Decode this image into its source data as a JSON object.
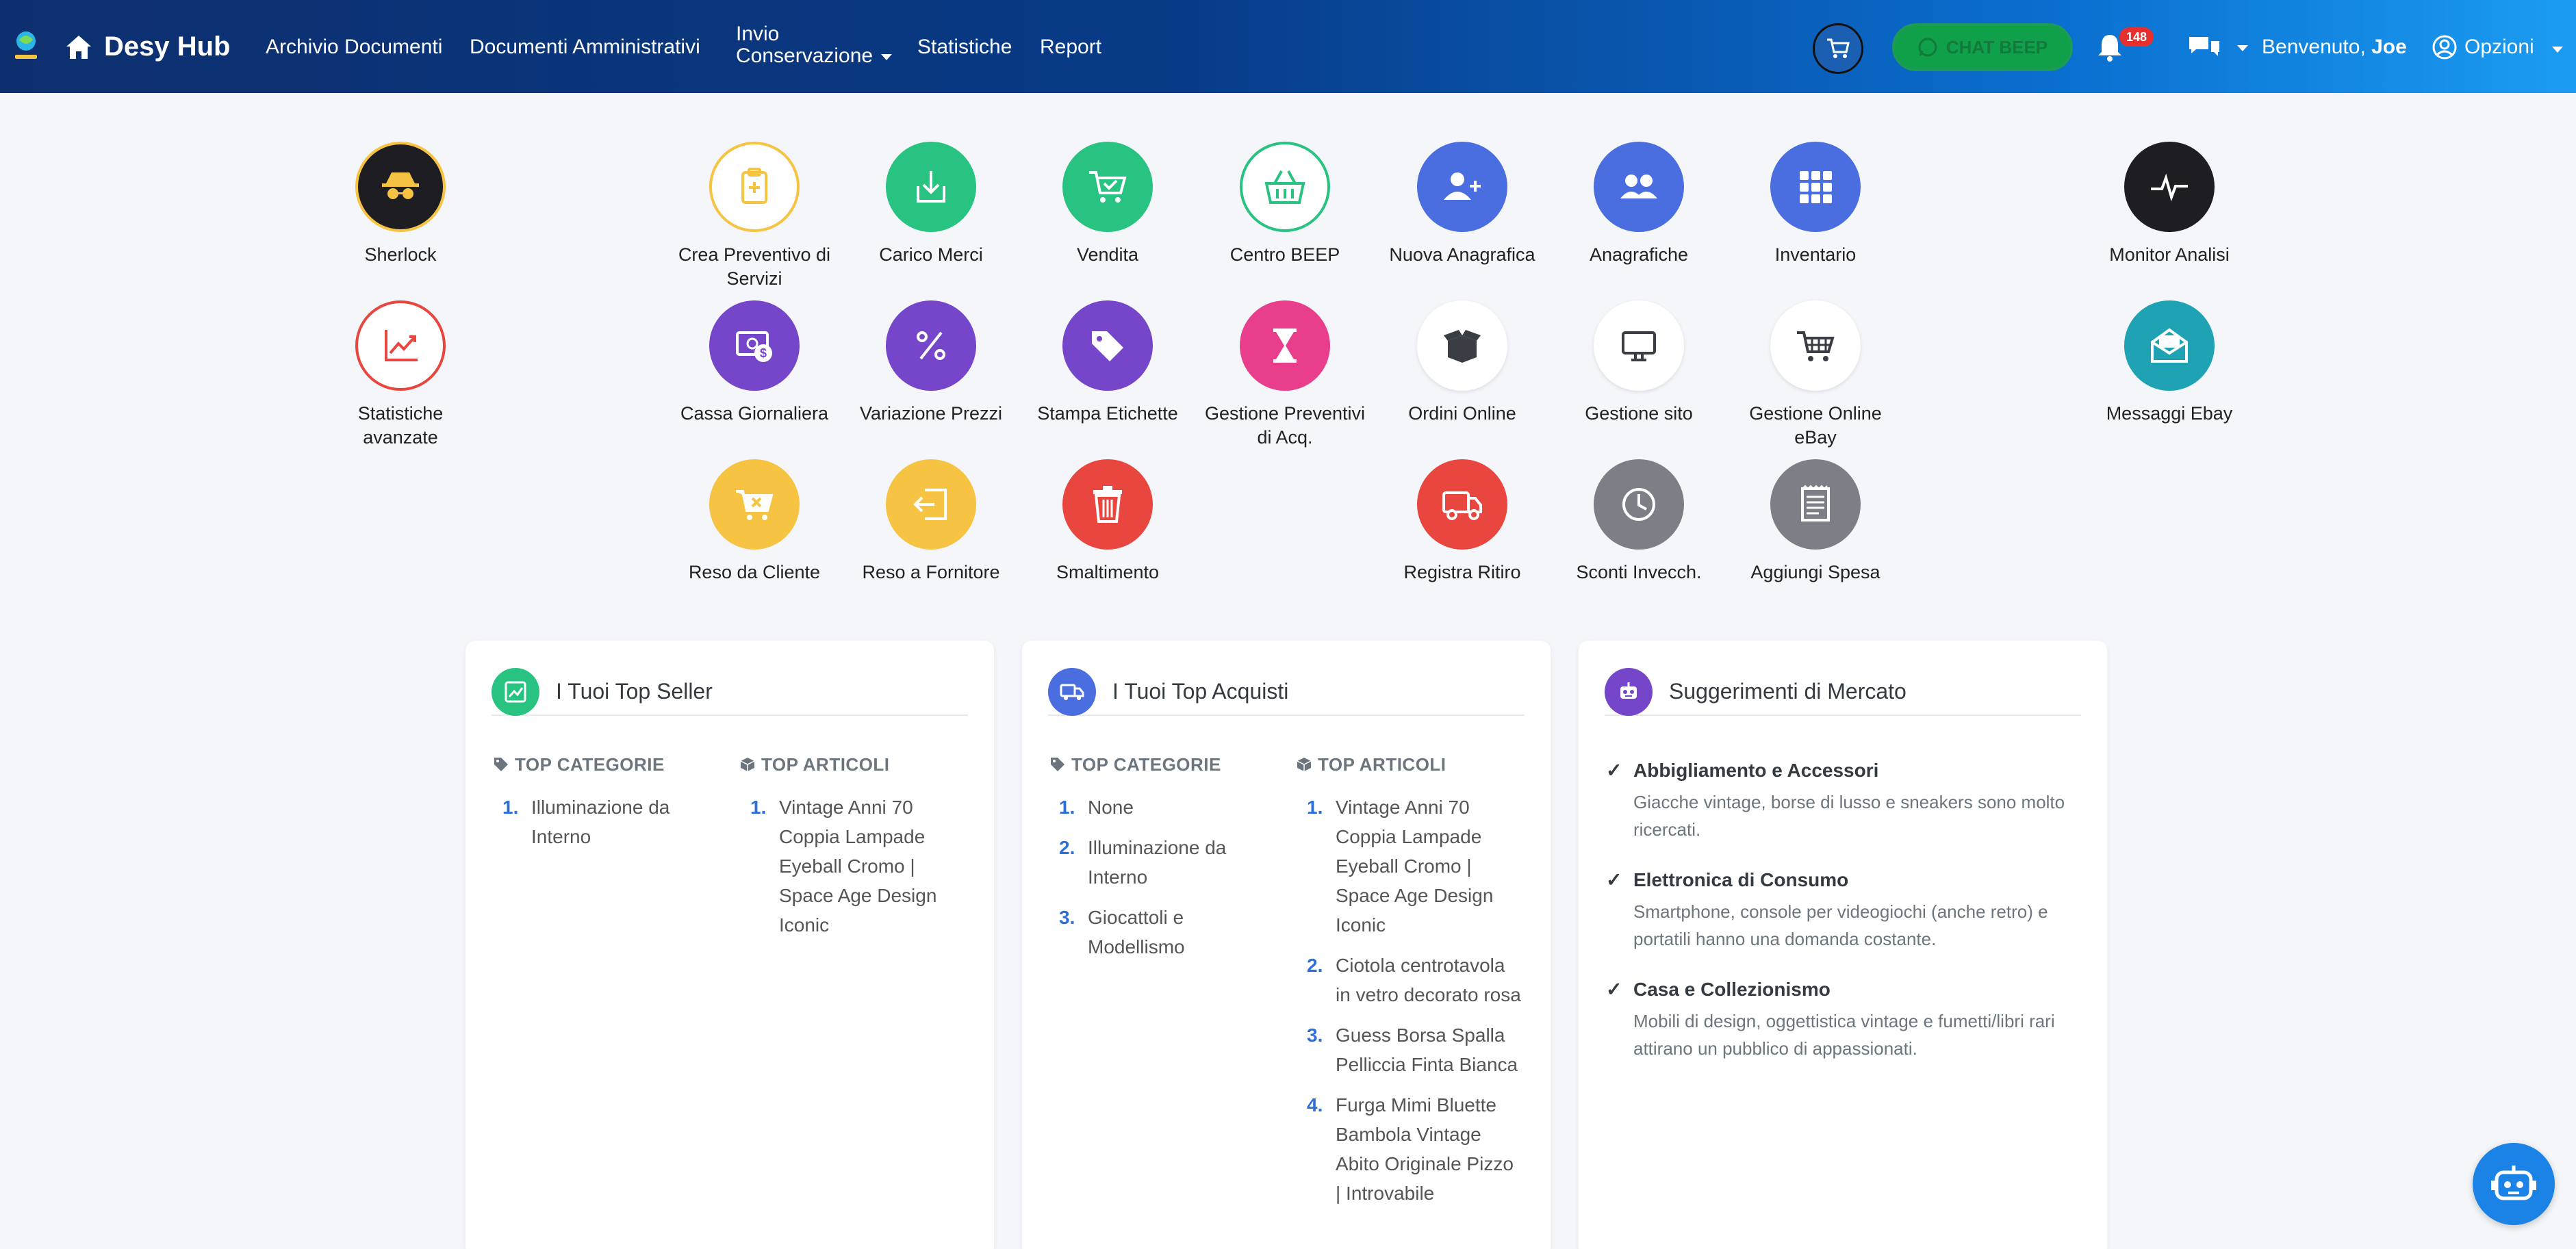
{
  "navbar": {
    "brand": "Desy Hub",
    "links": [
      "Archivio Documenti",
      "Documenti Amministrativi",
      "Statistiche",
      "Report"
    ],
    "invio_line1": "Invio",
    "invio_line2": "Conservazione",
    "chat_beep": "CHAT BEEP",
    "notifications_count": "148",
    "welcome_prefix": "Benvenuto, ",
    "welcome_user": "Joe",
    "options": "Opzioni"
  },
  "tiles": {
    "sherlock": "Sherlock",
    "crea_preventivo": "Crea Preventivo di Servizi",
    "carico_merci": "Carico Merci",
    "vendita": "Vendita",
    "centro_beep": "Centro BEEP",
    "nuova_anagrafica": "Nuova Anagrafica",
    "anagrafiche": "Anagrafiche",
    "inventario": "Inventario",
    "monitor_analisi": "Monitor Analisi",
    "statistiche_avanzate": "Statistiche avanzate",
    "cassa_giornaliera": "Cassa Giornaliera",
    "variazione_prezzi": "Variazione Prezzi",
    "stampa_etichette": "Stampa Etichette",
    "gestione_preventivi": "Gestione Preventivi di Acq.",
    "ordini_online": "Ordini Online",
    "gestione_sito": "Gestione sito",
    "gestione_ebay": "Gestione Online eBay",
    "messaggi_ebay": "Messaggi Ebay",
    "reso_cliente": "Reso da Cliente",
    "reso_fornitore": "Reso a Fornitore",
    "smaltimento": "Smaltimento",
    "registra_ritiro": "Registra Ritiro",
    "sconti_invecch": "Sconti Invecch.",
    "aggiungi_spesa": "Aggiungi Spesa"
  },
  "top_seller": {
    "title": "I Tuoi Top Seller",
    "cat_head": "TOP CATEGORIE",
    "art_head": "TOP ARTICOLI",
    "categories": [
      "Illuminazione da Interno"
    ],
    "articles": [
      "Vintage Anni 70 Coppia Lampade Eyeball Cromo | Space Age Design Iconic"
    ]
  },
  "top_acquisti": {
    "title": "I Tuoi Top Acquisti",
    "cat_head": "TOP CATEGORIE",
    "art_head": "TOP ARTICOLI",
    "categories": [
      "None",
      "Illuminazione da Interno",
      "Giocattoli e Modellismo"
    ],
    "articles": [
      "Vintage Anni 70 Coppia Lampade Eyeball Cromo | Space Age Design Iconic",
      "Ciotola centrotavola in vetro decorato rosa",
      "Guess Borsa Spalla Pelliccia Finta Bianca",
      "Furga Mimi Bluette Bambola Vintage Abito Originale Pizzo | Introvabile"
    ]
  },
  "suggerimenti": {
    "title": "Suggerimenti di Mercato",
    "items": [
      {
        "title": "Abbigliamento e Accessori",
        "text": "Giacche vintage, borse di lusso e sneakers sono molto ricercati."
      },
      {
        "title": "Elettronica di Consumo",
        "text": "Smartphone, console per videogiochi (anche retro) e portatili hanno una domanda costante."
      },
      {
        "title": "Casa e Collezionismo",
        "text": "Mobili di design, oggettistica vintage e fumetti/libri rari attirano un pubblico di appassionati."
      }
    ]
  },
  "colors": {
    "green": "#28c281",
    "purple": "#7546c9",
    "blue": "#4a6ee0",
    "red": "#e9463f",
    "yellow": "#f6c343",
    "pink": "#e83e8c",
    "gray": "#7d7f87",
    "teal": "#1fa2b4",
    "dark": "#1e1e22"
  }
}
